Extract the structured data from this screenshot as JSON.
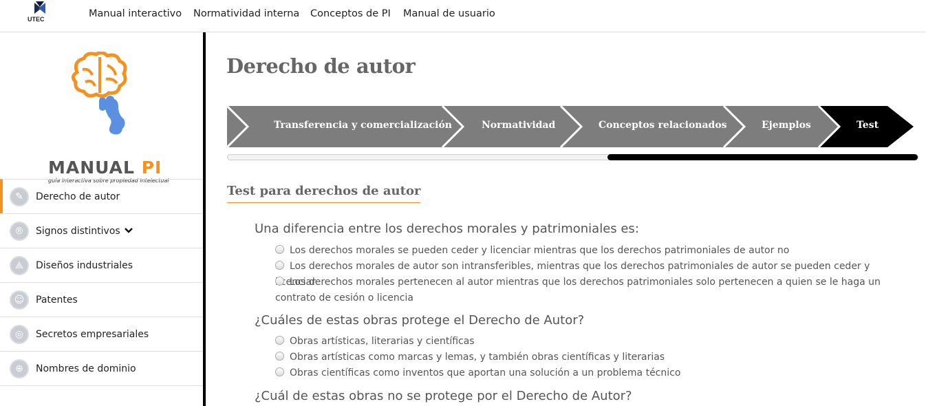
{
  "header": {
    "logo_text": "UTEC",
    "nav": [
      "Manual interactivo",
      "Normatividad interna",
      "Conceptos de PI",
      "Manual de usuario"
    ]
  },
  "brand": {
    "title_main": "MANUAL",
    "title_accent": "PI",
    "subtitle": "guía interactiva sobre propiedad intelectual"
  },
  "sidebar": {
    "items": [
      {
        "label": "Derecho de autor",
        "icon": "palette-icon"
      },
      {
        "label": "Signos distintivos",
        "icon": "registered-icon",
        "chevron": "❯"
      },
      {
        "label": "Diseños industriales",
        "icon": "compass-icon"
      },
      {
        "label": "Patentes",
        "icon": "head-gear-icon"
      },
      {
        "label": "Secretos empresariales",
        "icon": "fingerprint-icon"
      },
      {
        "label": "Nombres de dominio",
        "icon": "globe-icon"
      }
    ]
  },
  "main": {
    "title": "Derecho de autor",
    "steps": [
      "Transferencia y comercialización",
      "Normatividad",
      "Conceptos relacionados",
      "Ejemplos",
      "Test"
    ],
    "progress": 0.45,
    "section_title": "Test para derechos de autor",
    "questions": [
      {
        "text": "Una diferencia entre los derechos morales y patrimoniales es:",
        "options": [
          "Los derechos morales se pueden ceder y licenciar mientras que los derechos patrimoniales de autor no",
          "Los derechos morales de autor son intransferibles, mientras que los derechos patrimoniales de autor se pueden ceder y licenciar",
          "Los derechos morales pertenecen al autor mientras que los derechos patrimoniales solo pertenecen a quien se le haga un contrato de cesión o licencia"
        ]
      },
      {
        "text": "¿Cuáles de estas obras protege el Derecho de Autor?",
        "options": [
          "Obras artísticas, literarias y científicas",
          "Obras artísticas como marcas y lemas, y también obras científicas y literarias",
          "Obras científicas como inventos que aportan una solución a un problema técnico"
        ]
      },
      {
        "text": "¿Cuál de estas obras no se protege por el Derecho de Autor?",
        "options": []
      }
    ]
  }
}
